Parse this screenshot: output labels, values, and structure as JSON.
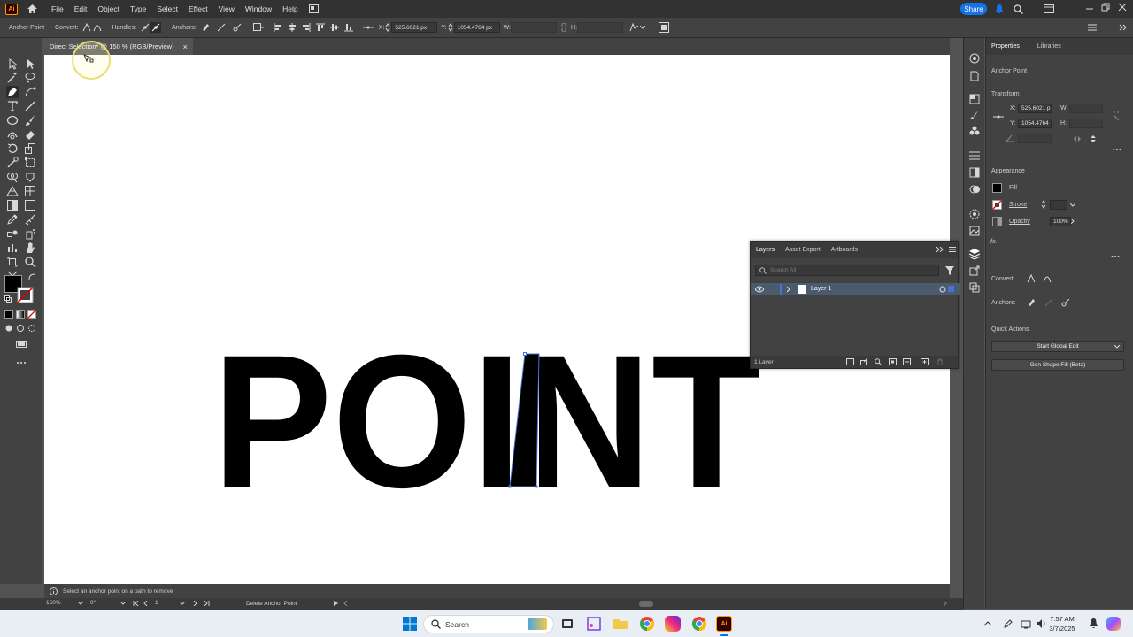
{
  "app": {
    "logo": "Ai",
    "menu": [
      "File",
      "Edit",
      "Object",
      "Type",
      "Select",
      "Effect",
      "View",
      "Window",
      "Help"
    ],
    "share_label": "Share"
  },
  "control_bar": {
    "tool_name": "Anchor Point",
    "convert_label": "Convert:",
    "handles_label": "Handles:",
    "anchors_label": "Anchors:",
    "x_label": "X:",
    "x_value": "525.6021 px",
    "y_label": "Y:",
    "y_value": "1054.4764 px",
    "w_label": "W:",
    "h_label": "H:"
  },
  "document": {
    "tab_title": "Direct Selection* @ 150 % (RGB/Preview)",
    "close_glyph": "×"
  },
  "artwork": {
    "text": "POINT",
    "fill": "#000000",
    "selection_color": "#4a6fd8"
  },
  "properties": {
    "tabs": [
      "Properties",
      "Libraries"
    ],
    "selection_type": "Anchor Point",
    "transform_title": "Transform",
    "x_label": "X:",
    "x_value": "525.6021 p",
    "y_label": "Y:",
    "y_value": "1054.4764",
    "w_label": "W:",
    "h_label": "H:",
    "appearance_title": "Appearance",
    "fill_label": "Fill",
    "stroke_label": "Stroke",
    "opacity_label": "Opacity",
    "opacity_value": "100%",
    "fx_label": "fx.",
    "convert_label": "Convert:",
    "anchors_label": "Anchors:",
    "quick_actions_title": "Quick Actions",
    "start_global_edit": "Start Global Edit",
    "gen_shape_fill": "Gen Shape Fill (Beta)"
  },
  "layers_panel": {
    "tabs": [
      "Layers",
      "Asset Export",
      "Artboards"
    ],
    "search_placeholder": "Search All",
    "layer_name": "Layer 1",
    "layer_count": "1 Layer"
  },
  "status": {
    "hint": "Select an anchor point on a path to remove",
    "zoom": "150%",
    "rotation": "0°",
    "artboard": "1",
    "tool_status": "Delete Anchor Point"
  },
  "taskbar": {
    "search_label": "Search",
    "time": "7:57 AM",
    "date": "3/7/2025"
  },
  "colors": {
    "chrome_dark": "#323232",
    "panel": "#424242",
    "accent_blue": "#1473e6",
    "illustrator_orange": "#ff9a00"
  }
}
